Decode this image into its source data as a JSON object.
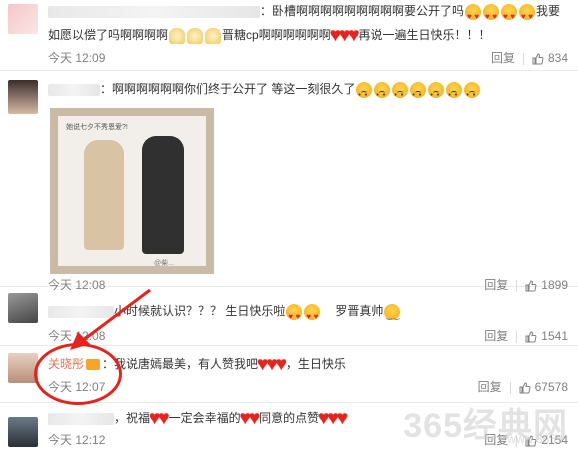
{
  "comments": [
    {
      "text_pre": "：卧槽啊啊啊啊啊啊啊啊啊要公开了吗",
      "text_mid": "我要如愿以偿了吗啊啊啊啊",
      "text_mid2": "晋糖cp啊啊啊啊啊啊",
      "text_post": "再说一遍生日快乐！！！",
      "time": "今天 12:09",
      "reply": "回复",
      "likes": "834"
    },
    {
      "text_pre": "：啊啊啊啊啊啊你们终于公开了 等这一刻很久了",
      "image_caption": "她说七夕不秀恩爱?!",
      "image_watermark": "@柴...",
      "time": "今天 12:08",
      "reply": "回复",
      "likes": "1899"
    },
    {
      "text_pre": "小时候就认识？？？ 生日快乐啦",
      "text_post": "罗晋真帅",
      "time": "今天 12:08",
      "reply": "回复",
      "likes": "1541"
    },
    {
      "username": "关晓彤",
      "text_pre": "：我说唐嫣最美，有人赞我吧",
      "text_post": "，生日快乐",
      "time": "今天 12:07",
      "reply": "回复",
      "likes": "67578"
    },
    {
      "text_pre": "，祝福",
      "text_mid": "一定会幸福的",
      "text_mid2": "同意的点赞",
      "time": "今天 12:12",
      "reply": "回复",
      "likes": "2154"
    }
  ],
  "watermark": {
    "main": "365经典网",
    "sub": "www.365..."
  },
  "colors": {
    "username": "#eb7350",
    "annotation": "#e8221c",
    "meta": "#808080"
  },
  "icons": [
    "like-thumb-icon",
    "heart-eyes-emoji",
    "sad-emoji",
    "pray-emoji",
    "red-heart",
    "crown-badge-icon"
  ]
}
